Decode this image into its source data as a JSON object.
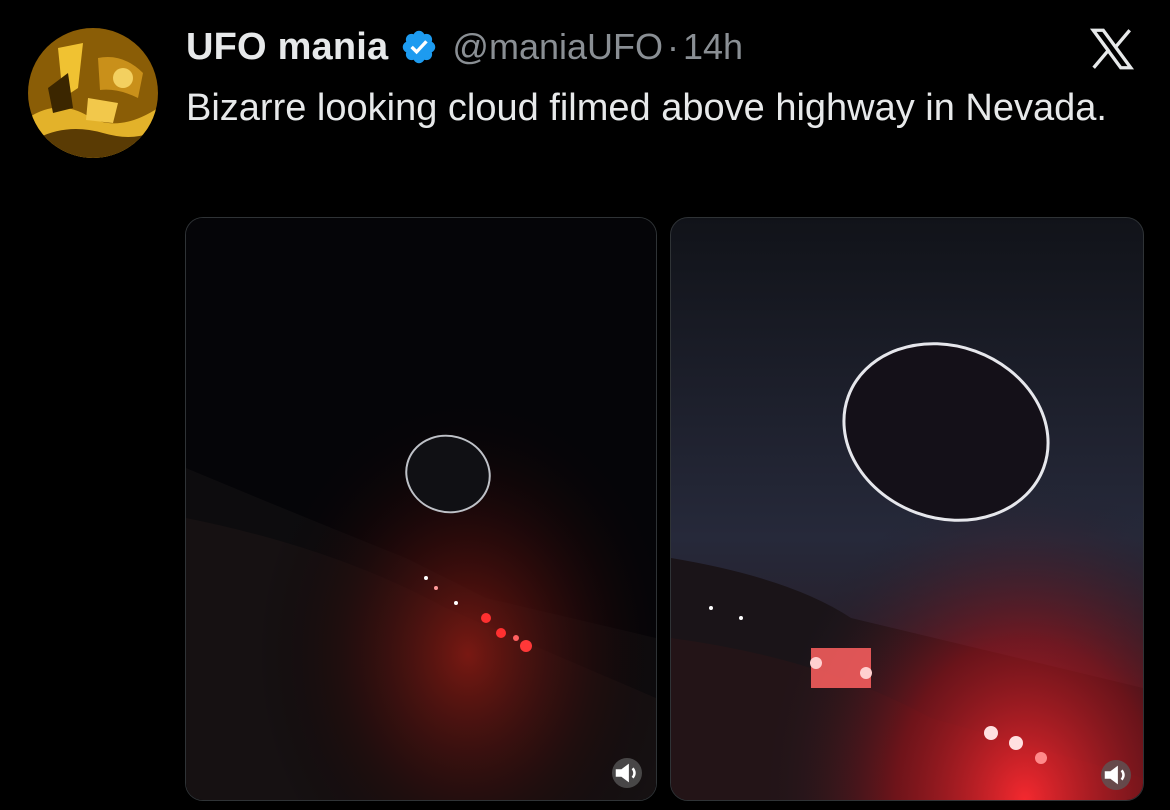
{
  "tweet": {
    "display_name": "UFO mania",
    "handle": "@maniaUFO",
    "separator": "·",
    "time": "14h",
    "text": "Bizarre looking cloud filmed above highway in Nevada.",
    "verified_color": "#1d9bf0"
  },
  "icons": {
    "verified": "verified-badge-icon",
    "platform": "x-logo-icon",
    "sound": "speaker-icon"
  },
  "media": [
    {
      "kind": "video",
      "description_icon": "speaker-icon"
    },
    {
      "kind": "video",
      "description_icon": "speaker-icon"
    }
  ],
  "colors": {
    "background": "#000000",
    "text": "#e7e9ea",
    "muted": "#8a8f94",
    "border": "#2f3336"
  }
}
